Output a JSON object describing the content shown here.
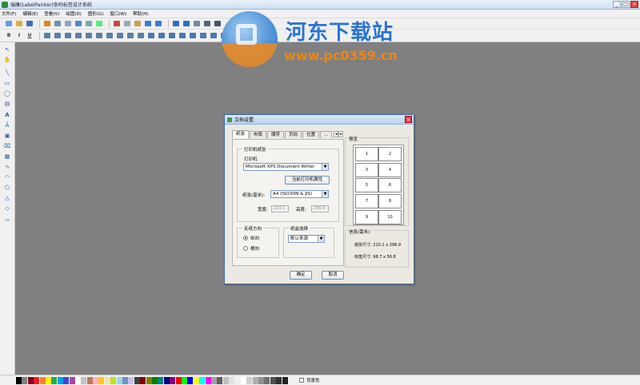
{
  "window": {
    "title": "瑞康(LabelPainter)条码标签设计系统",
    "controls": [
      "_",
      "□",
      "×"
    ]
  },
  "menu": [
    "文件(F)",
    "编辑(E)",
    "查看(V)",
    "绘图(D)",
    "图形(G)",
    "窗口(W)",
    "帮助(H)"
  ],
  "format_bar": {
    "bold": "B",
    "italic": "I",
    "underline": "U"
  },
  "watermark": {
    "brand": "河东下载站",
    "url": "www.pc0359.cn"
  },
  "dialog": {
    "title": "文档设置",
    "close": "×",
    "tabs": [
      "纸张",
      "布局",
      "顺序",
      "页码",
      "位置",
      "..."
    ],
    "tab_nav": [
      "◂",
      "▸"
    ],
    "printer_group": "打印机纸张",
    "printer_label": "打印机",
    "printer_value": "Microsoft XPS Document Writer",
    "printer_props_button": "当前打印机属性",
    "paper_label": "纸张(毫米):",
    "paper_value": "A4 (ISO/DIN & JIS)",
    "width_label": "宽度:",
    "width_value": "210.1",
    "height_label": "高度:",
    "height_value": "296.9",
    "orientation_group": "走纸方向",
    "portrait": "纵向",
    "landscape": "横向",
    "tray_group": "纸盒选择",
    "tray_value": "默认来源",
    "preview_group": "预览",
    "preview_cells": [
      "1",
      "2",
      "3",
      "4",
      "5",
      "6",
      "7",
      "8",
      "9",
      "10"
    ],
    "info_group": "信息(毫米)",
    "paper_size": "纸张尺寸: 210.1 x 296.9",
    "label_size": "标签尺寸: 98.7 x 56.8",
    "ok_button": "确定",
    "cancel_button": "取消"
  },
  "palette": {
    "bg_label": "背景色",
    "colors": [
      "#000000",
      "#7f7f7f",
      "#880015",
      "#ed1c24",
      "#ff7f27",
      "#fff200",
      "#22b14c",
      "#00a2e8",
      "#3f48cc",
      "#a349a4",
      "#ffffff",
      "#c3c3c3",
      "#b97a57",
      "#ffaec9",
      "#ffc90e",
      "#efe4b0",
      "#b5e61d",
      "#99d9ea",
      "#7092be",
      "#c8bfe7",
      "#404040",
      "#800000",
      "#808000",
      "#008000",
      "#008080",
      "#000080",
      "#800080",
      "#ff0000",
      "#00ff00",
      "#0000ff",
      "#ffff00",
      "#00ffff",
      "#ff00ff",
      "#a0a0a0",
      "#606060",
      "#c0c0c0",
      "#e0e0e0",
      "#f0f0f0",
      "#ffffff",
      "#d0d0d0",
      "#b0b0b0",
      "#909090",
      "#707070",
      "#505050",
      "#303030",
      "#202020"
    ]
  }
}
